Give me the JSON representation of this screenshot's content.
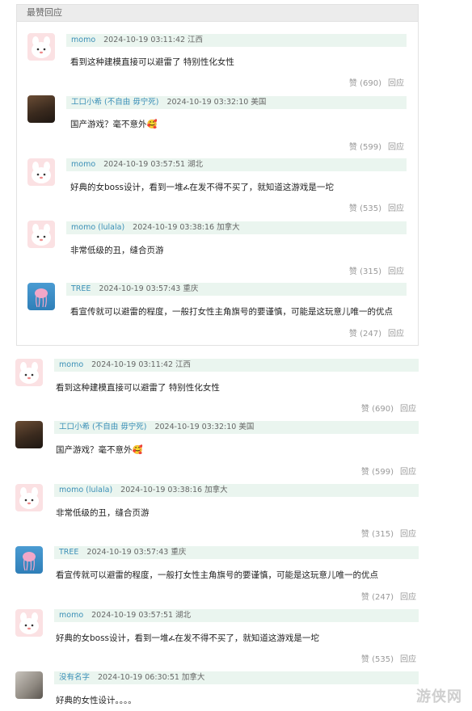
{
  "section": {
    "title": "最赞回应"
  },
  "labels": {
    "like": "赞",
    "reply": "回应"
  },
  "hot_comments": [
    {
      "user": "momo",
      "time": "2024-10-19 03:11:42",
      "location": "江西",
      "text": "看到这种建模直接可以避雷了 特别性化女性",
      "likes": "(690)",
      "avatar": "pink-bunny-avatar"
    },
    {
      "user": "工口小希 (不自由 毋宁死)",
      "time": "2024-10-19 03:32:10",
      "location": "美国",
      "text": "国产游戏？毫不意外🥰",
      "likes": "(599)",
      "avatar": "photo-avatar"
    },
    {
      "user": "momo",
      "time": "2024-10-19 03:57:51",
      "location": "湖北",
      "text": "好典的女boss设计，看到一堆ፈ在发不得不买了，就知道这游戏是一坨",
      "likes": "(535)",
      "avatar": "pink-bunny-avatar"
    },
    {
      "user": "momo (lulala)",
      "time": "2024-10-19 03:38:16",
      "location": "加拿大",
      "text": "非常低级的丑，缝合页游",
      "likes": "(315)",
      "avatar": "pink-bunny-avatar"
    },
    {
      "user": "TREE",
      "time": "2024-10-19 03:57:43",
      "location": "重庆",
      "text": "看宣传就可以避雷的程度，一般打女性主角旗号的要谨慎，可能是这玩意儿唯一的优点",
      "likes": "(247)",
      "avatar": "jellyfish-avatar"
    }
  ],
  "comments": [
    {
      "user": "momo",
      "time": "2024-10-19 03:11:42",
      "location": "江西",
      "text": "看到这种建模直接可以避雷了 特别性化女性",
      "likes": "(690)",
      "avatar": "pink-bunny-avatar"
    },
    {
      "user": "工口小希 (不自由 毋宁死)",
      "time": "2024-10-19 03:32:10",
      "location": "美国",
      "text": "国产游戏？毫不意外🥰",
      "likes": "(599)",
      "avatar": "photo-avatar"
    },
    {
      "user": "momo (lulala)",
      "time": "2024-10-19 03:38:16",
      "location": "加拿大",
      "text": "非常低级的丑，缝合页游",
      "likes": "(315)",
      "avatar": "pink-bunny-avatar"
    },
    {
      "user": "TREE",
      "time": "2024-10-19 03:57:43",
      "location": "重庆",
      "text": "看宣传就可以避雷的程度，一般打女性主角旗号的要谨慎，可能是这玩意儿唯一的优点",
      "likes": "(247)",
      "avatar": "jellyfish-avatar"
    },
    {
      "user": "momo",
      "time": "2024-10-19 03:57:51",
      "location": "湖北",
      "text": "好典的女boss设计，看到一堆ፈ在发不得不买了，就知道这游戏是一坨",
      "likes": "(535)",
      "avatar": "pink-bunny-avatar"
    },
    {
      "user": "没有名字",
      "time": "2024-10-19 06:30:51",
      "location": "加拿大",
      "text": "好典的女性设计。。。。",
      "likes": "",
      "avatar": "cat-avatar"
    }
  ],
  "watermark": "游侠网"
}
